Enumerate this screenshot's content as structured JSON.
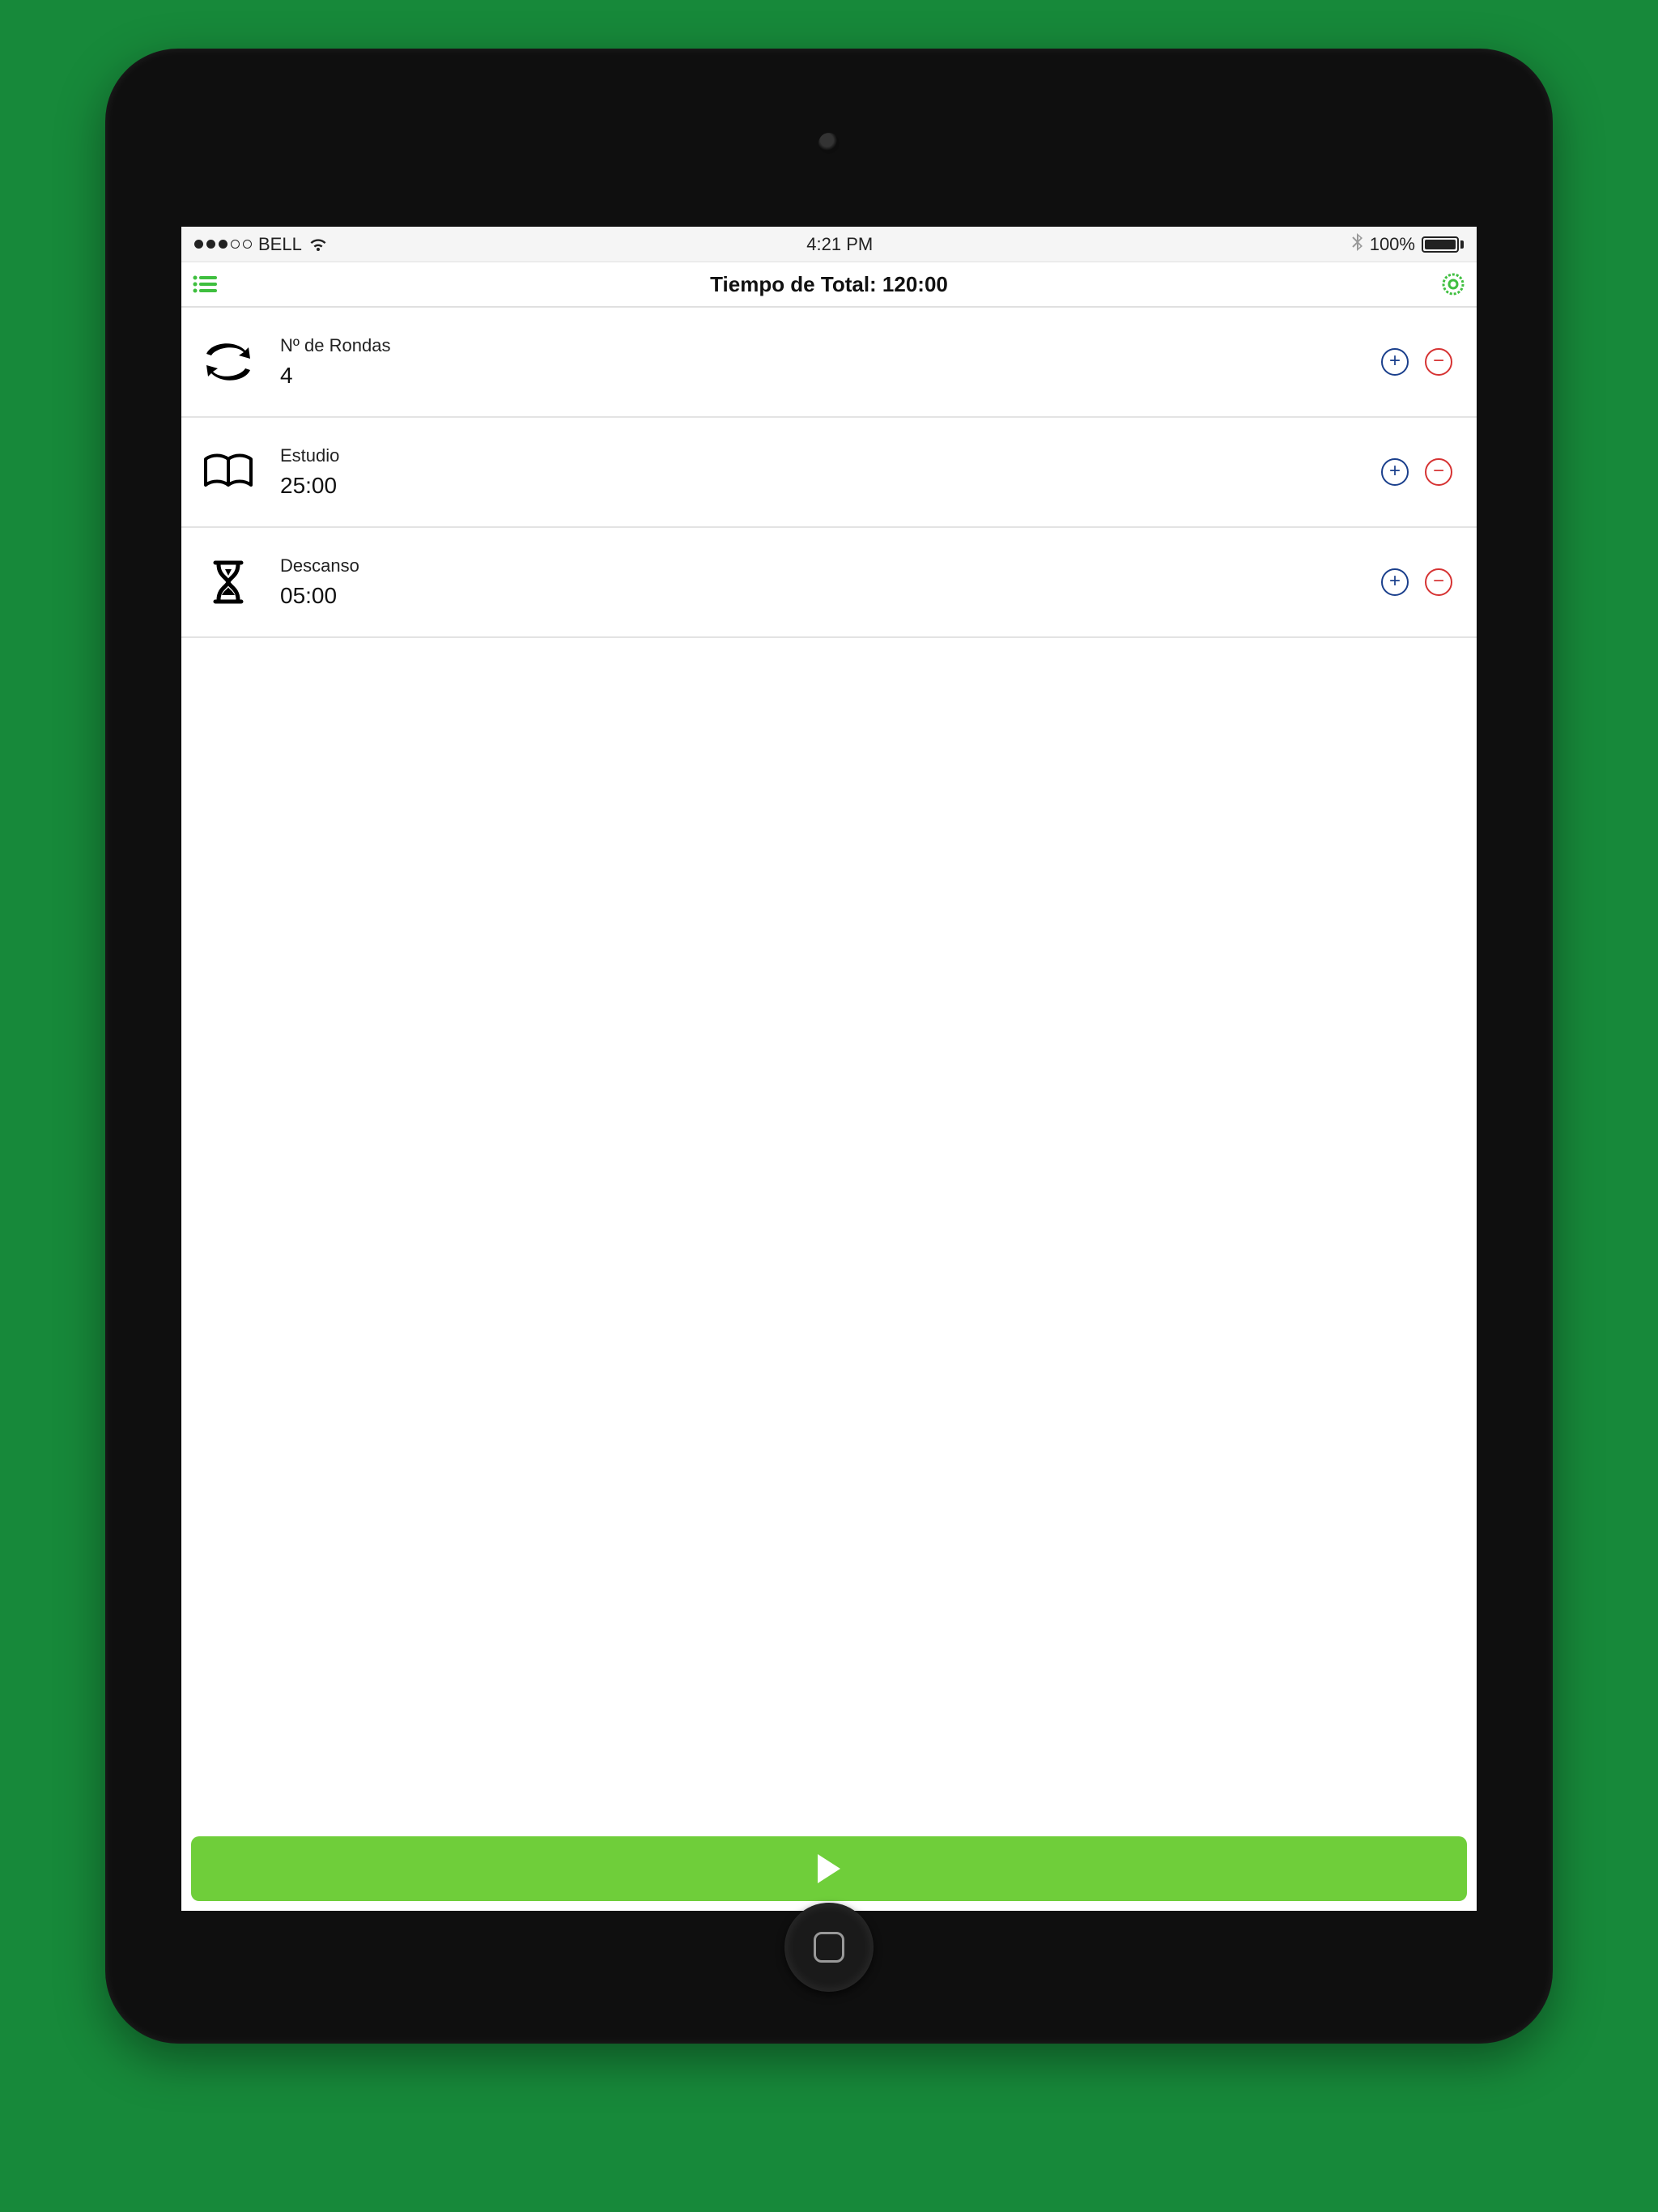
{
  "status": {
    "carrier": "BELL",
    "time": "4:21 PM",
    "battery_pct": "100%"
  },
  "header": {
    "title": "Tiempo de Total: 120:00"
  },
  "rows": [
    {
      "label": "Nº de Rondas",
      "value": "4"
    },
    {
      "label": "Estudio",
      "value": "25:00"
    },
    {
      "label": "Descanso",
      "value": "05:00"
    }
  ],
  "colors": {
    "accent_green": "#6fce3a",
    "plus_blue": "#1a3f8c",
    "minus_red": "#d63333"
  }
}
